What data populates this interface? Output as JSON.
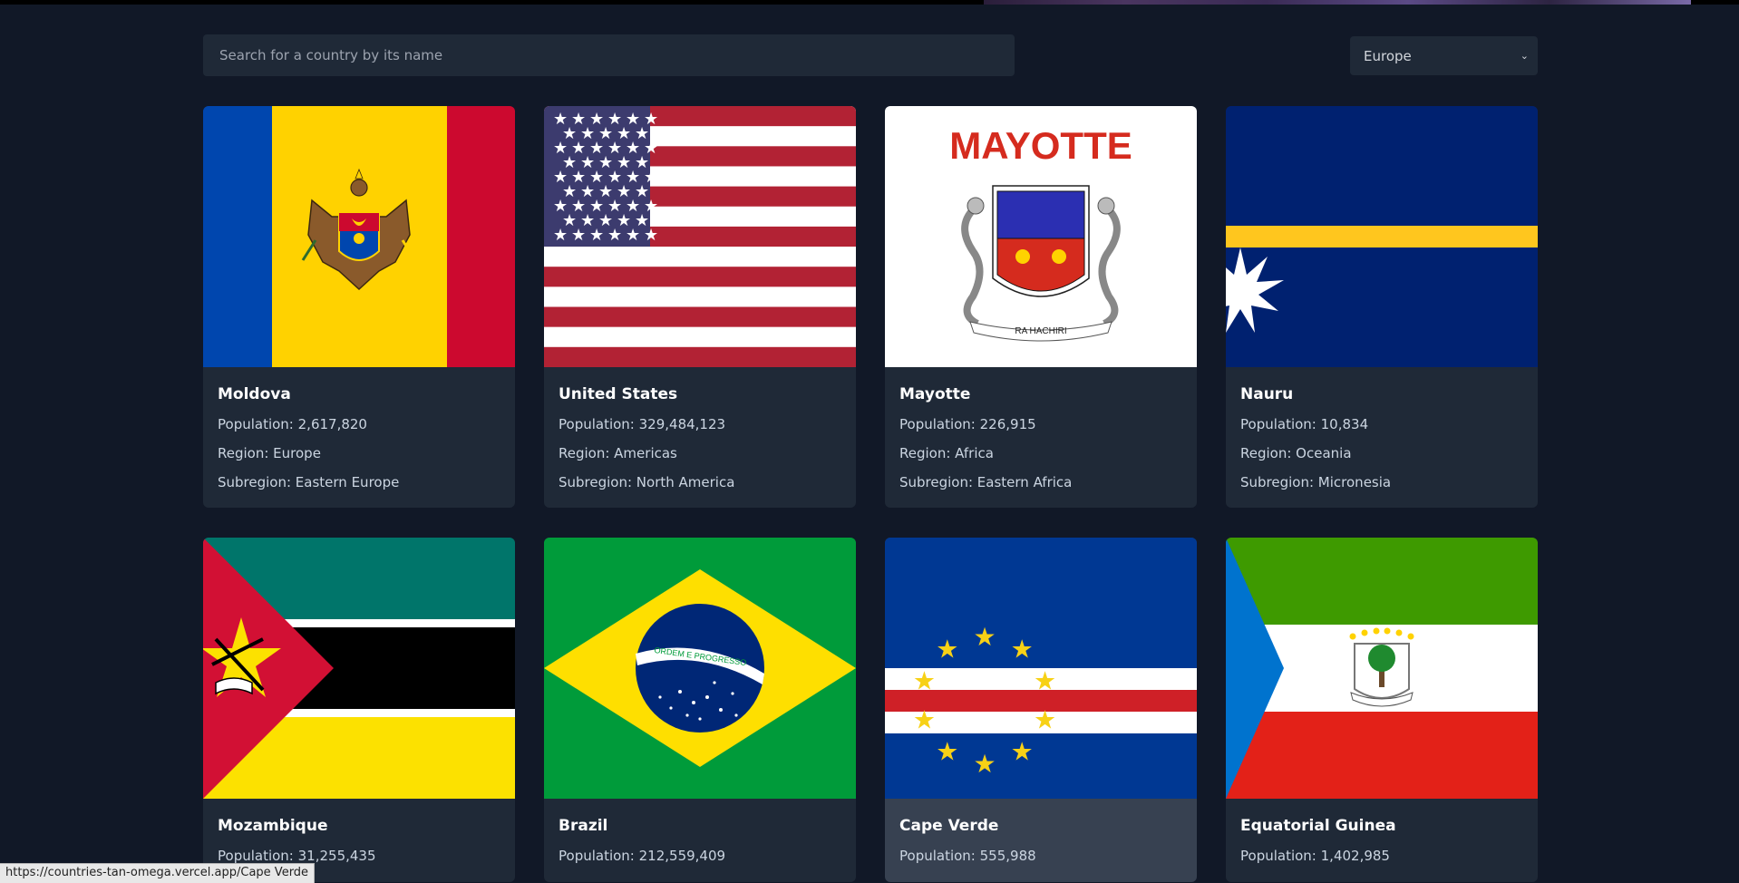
{
  "search": {
    "placeholder": "Search for a country by its name",
    "value": ""
  },
  "filter": {
    "selected": "Europe"
  },
  "countries": [
    {
      "name": "Moldova",
      "population": "Population: 2,617,820",
      "region": "Region: Europe",
      "subregion": "Subregion: Eastern Europe",
      "flag": "moldova-flag"
    },
    {
      "name": "United States",
      "population": "Population: 329,484,123",
      "region": "Region: Americas",
      "subregion": "Subregion: North America",
      "flag": "usa-flag"
    },
    {
      "name": "Mayotte",
      "population": "Population: 226,915",
      "region": "Region: Africa",
      "subregion": "Subregion: Eastern Africa",
      "flag": "mayotte-flag",
      "flag_text": "MAYOTTE",
      "flag_motto": "RA HACHIRI"
    },
    {
      "name": "Nauru",
      "population": "Population: 10,834",
      "region": "Region: Oceania",
      "subregion": "Subregion: Micronesia",
      "flag": "nauru-flag"
    },
    {
      "name": "Mozambique",
      "population": "Population: 31,255,435",
      "flag": "mozambique-flag"
    },
    {
      "name": "Brazil",
      "population": "Population: 212,559,409",
      "flag": "brazil-flag",
      "flag_motto": "ORDEM E PROGRESSO"
    },
    {
      "name": "Cape Verde",
      "population": "Population: 555,988",
      "flag": "cape-verde-flag"
    },
    {
      "name": "Equatorial Guinea",
      "population": "Population: 1,402,985",
      "flag": "equatorial-guinea-flag"
    }
  ],
  "status_url": "https://countries-tan-omega.vercel.app/Cape Verde"
}
